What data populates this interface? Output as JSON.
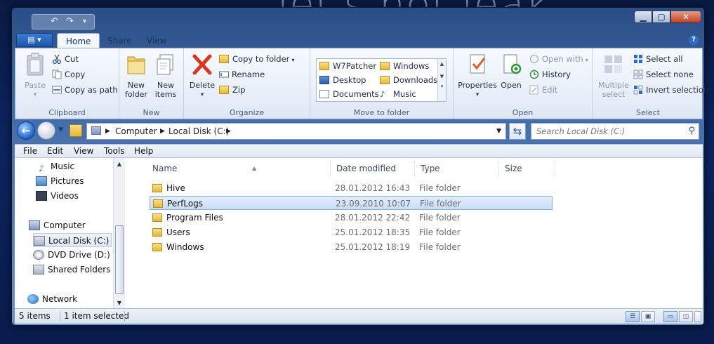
{
  "wallpaper": {
    "text": "let's not leak"
  },
  "titlebar": {
    "qat": {
      "undo": "↶",
      "redo": "↷",
      "menu": "▾"
    },
    "buttons": {
      "minimize": "▁",
      "maximize": "▢",
      "close": "✕"
    }
  },
  "ribbon_tabs": {
    "file": "▤ ▾",
    "tabs": [
      "Home",
      "Share",
      "View"
    ],
    "active": "Home",
    "help": "?"
  },
  "ribbon": {
    "clipboard": {
      "label": "Clipboard",
      "paste": "Paste",
      "cut": "Cut",
      "copy": "Copy",
      "copy_as_path": "Copy as path"
    },
    "new": {
      "label": "New",
      "new_folder": "New folder",
      "new_items": "New items"
    },
    "organize": {
      "label": "Organize",
      "delete": "Delete",
      "copy_to_folder": "Copy to folder",
      "rename": "Rename",
      "zip": "Zip"
    },
    "move_to_folder": {
      "label": "Move to folder",
      "items": [
        "W7Patcher",
        "Windows",
        "Desktop",
        "Downloads",
        "Documents",
        "Music"
      ]
    },
    "open": {
      "label": "Open",
      "properties": "Properties",
      "open": "Open",
      "open_with": "Open with",
      "history": "History",
      "edit": "Edit"
    },
    "select": {
      "label": "Select",
      "multiple_select": "Multiple select",
      "select_all": "Select all",
      "select_none": "Select none",
      "invert_selection": "Invert selection"
    }
  },
  "address": {
    "crumbs": [
      "Computer",
      "Local Disk (C:)"
    ],
    "search_placeholder": "Search Local Disk (C:)"
  },
  "menubar": [
    "File",
    "Edit",
    "View",
    "Tools",
    "Help"
  ],
  "nav_pane": {
    "items": [
      "Music",
      "Pictures",
      "Videos",
      "Computer",
      "Local Disk (C:)",
      "DVD Drive (D:) VM",
      "Shared Folders (\\",
      "Network"
    ],
    "selected": "Local Disk (C:)"
  },
  "file_list": {
    "columns": [
      "Name",
      "Date modified",
      "Type",
      "Size"
    ],
    "rows": [
      {
        "name": "Hive",
        "date": "28.01.2012 16:43",
        "type": "File folder",
        "size": ""
      },
      {
        "name": "PerfLogs",
        "date": "23.09.2010 10:07",
        "type": "File folder",
        "size": ""
      },
      {
        "name": "Program Files",
        "date": "28.01.2012 22:42",
        "type": "File folder",
        "size": ""
      },
      {
        "name": "Users",
        "date": "25.01.2012 18:35",
        "type": "File folder",
        "size": ""
      },
      {
        "name": "Windows",
        "date": "25.01.2012 18:19",
        "type": "File folder",
        "size": ""
      }
    ],
    "selected_row": "PerfLogs"
  },
  "status": {
    "count": "5 items",
    "selection": "1 item selected"
  },
  "colors": {
    "accent": "#1c57ad",
    "selection": "#c9ddf6",
    "ribbon_bg": "#e7eef9"
  }
}
